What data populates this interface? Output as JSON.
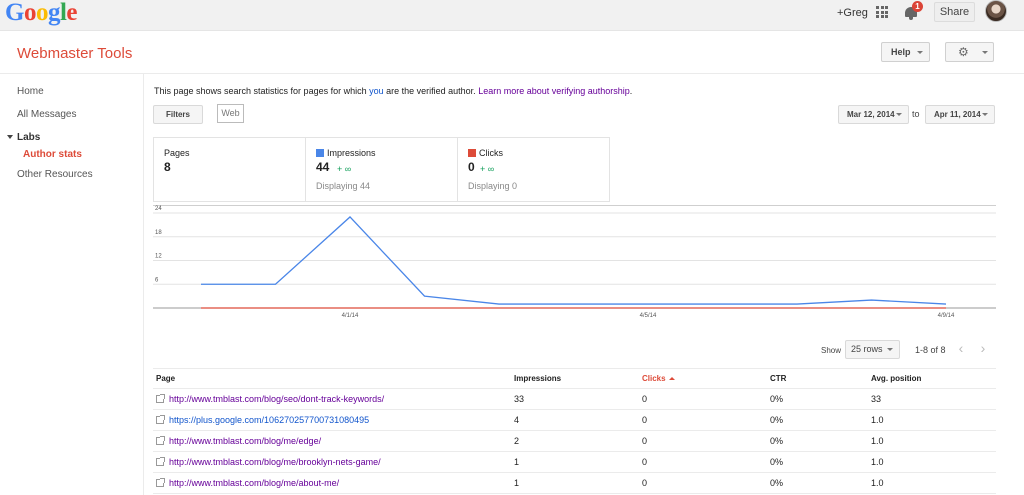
{
  "gbar": {
    "logo_letters": [
      {
        "ch": "G",
        "color": "#4285f4"
      },
      {
        "ch": "o",
        "color": "#ea4335"
      },
      {
        "ch": "o",
        "color": "#fbbc05"
      },
      {
        "ch": "g",
        "color": "#4285f4"
      },
      {
        "ch": "l",
        "color": "#34a853"
      },
      {
        "ch": "e",
        "color": "#ea4335"
      }
    ],
    "user": "+Greg",
    "notif_count": "1",
    "share": "Share"
  },
  "header": {
    "title": "Webmaster Tools",
    "help": "Help"
  },
  "sidebar": {
    "home": "Home",
    "messages": "All Messages",
    "labs": "Labs",
    "author_stats": "Author stats",
    "other": "Other Resources"
  },
  "main": {
    "intro_pre": "This page shows search statistics for pages for which ",
    "intro_you": "you",
    "intro_mid": " are the verified author. ",
    "intro_link": "Learn more about verifying authorship",
    "intro_end": ".",
    "filters": "Filters",
    "web": "Web",
    "date_from": "Mar 12, 2014",
    "date_to_label": "to",
    "date_to": "Apr 11, 2014"
  },
  "summary": {
    "pages_label": "Pages",
    "pages_value": "8",
    "impr_label": "Impressions",
    "impr_value": "44",
    "impr_delta": "+ ∞",
    "impr_sub": "Displaying 44",
    "clicks_label": "Clicks",
    "clicks_value": "0",
    "clicks_delta": "+ ∞",
    "clicks_sub": "Displaying 0"
  },
  "colors": {
    "impressions": "#4a86e8",
    "clicks": "#dd4b39",
    "accent": "#dd4b39",
    "link": "#1155cc",
    "visited": "#660099"
  },
  "chart_data": {
    "type": "line",
    "x": [
      "3/30/14",
      "3/31/14",
      "4/1/14",
      "4/2/14",
      "4/3/14",
      "4/4/14",
      "4/5/14",
      "4/6/14",
      "4/7/14",
      "4/8/14",
      "4/9/14"
    ],
    "x_ticks": [
      "4/1/14",
      "4/5/14",
      "4/9/14"
    ],
    "y_ticks": [
      "24",
      "18",
      "12",
      "6"
    ],
    "ylim": [
      0,
      24
    ],
    "grid": true,
    "series": [
      {
        "name": "Impressions",
        "color": "#4a86e8",
        "values": [
          6,
          6,
          23,
          3,
          1,
          1,
          1,
          1,
          1,
          2,
          1
        ]
      },
      {
        "name": "Clicks",
        "color": "#dd4b39",
        "values": [
          0,
          0,
          0,
          0,
          0,
          0,
          0,
          0,
          0,
          0,
          0
        ]
      }
    ]
  },
  "pager": {
    "show": "Show",
    "rows": "25 rows",
    "range": "1-8 of 8",
    "prev": "‹",
    "next": "›"
  },
  "table": {
    "headers": [
      "Page",
      "Impressions",
      "Clicks",
      "CTR",
      "Avg. position"
    ],
    "rows": [
      {
        "page": "http://www.tmblast.com/blog/seo/dont-track-keywords/",
        "impressions": "33",
        "clicks": "0",
        "ctr": "0%",
        "pos": "33"
      },
      {
        "page": "https://plus.google.com/106270257700731080495",
        "impressions": "4",
        "clicks": "0",
        "ctr": "0%",
        "pos": "1.0"
      },
      {
        "page": "http://www.tmblast.com/blog/me/edge/",
        "impressions": "2",
        "clicks": "0",
        "ctr": "0%",
        "pos": "1.0"
      },
      {
        "page": "http://www.tmblast.com/blog/me/brooklyn-nets-game/",
        "impressions": "1",
        "clicks": "0",
        "ctr": "0%",
        "pos": "1.0"
      },
      {
        "page": "http://www.tmblast.com/blog/me/about-me/",
        "impressions": "1",
        "clicks": "0",
        "ctr": "0%",
        "pos": "1.0"
      }
    ]
  }
}
